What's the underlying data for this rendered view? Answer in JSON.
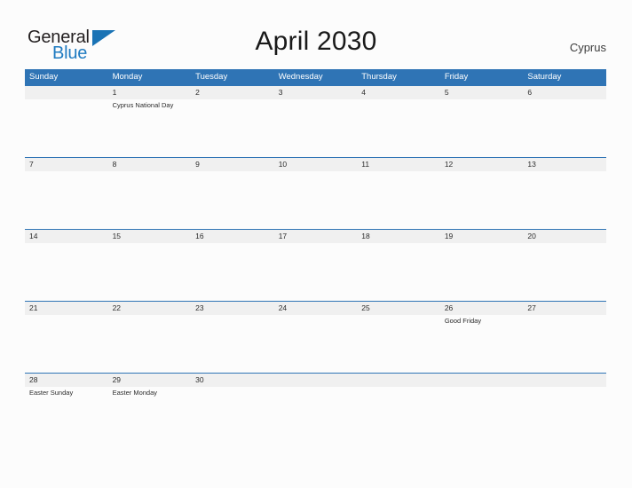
{
  "brand": {
    "name_part1": "General",
    "name_part2": "Blue",
    "flag_icon": "flag-triangle-icon"
  },
  "header": {
    "title": "April 2030",
    "region": "Cyprus"
  },
  "colors": {
    "header_blue": "#2f74b5",
    "band_gray": "#f0f0f0",
    "brand_blue": "#1f7bc1",
    "page_background": "#fcfcfc"
  },
  "calendar": {
    "day_names": [
      "Sunday",
      "Monday",
      "Tuesday",
      "Wednesday",
      "Thursday",
      "Friday",
      "Saturday"
    ],
    "weeks": [
      [
        {
          "day": "",
          "event": ""
        },
        {
          "day": "1",
          "event": "Cyprus National Day"
        },
        {
          "day": "2",
          "event": ""
        },
        {
          "day": "3",
          "event": ""
        },
        {
          "day": "4",
          "event": ""
        },
        {
          "day": "5",
          "event": ""
        },
        {
          "day": "6",
          "event": ""
        }
      ],
      [
        {
          "day": "7",
          "event": ""
        },
        {
          "day": "8",
          "event": ""
        },
        {
          "day": "9",
          "event": ""
        },
        {
          "day": "10",
          "event": ""
        },
        {
          "day": "11",
          "event": ""
        },
        {
          "day": "12",
          "event": ""
        },
        {
          "day": "13",
          "event": ""
        }
      ],
      [
        {
          "day": "14",
          "event": ""
        },
        {
          "day": "15",
          "event": ""
        },
        {
          "day": "16",
          "event": ""
        },
        {
          "day": "17",
          "event": ""
        },
        {
          "day": "18",
          "event": ""
        },
        {
          "day": "19",
          "event": ""
        },
        {
          "day": "20",
          "event": ""
        }
      ],
      [
        {
          "day": "21",
          "event": ""
        },
        {
          "day": "22",
          "event": ""
        },
        {
          "day": "23",
          "event": ""
        },
        {
          "day": "24",
          "event": ""
        },
        {
          "day": "25",
          "event": ""
        },
        {
          "day": "26",
          "event": "Good Friday"
        },
        {
          "day": "27",
          "event": ""
        }
      ],
      [
        {
          "day": "28",
          "event": "Easter Sunday"
        },
        {
          "day": "29",
          "event": "Easter Monday"
        },
        {
          "day": "30",
          "event": ""
        },
        {
          "day": "",
          "event": ""
        },
        {
          "day": "",
          "event": ""
        },
        {
          "day": "",
          "event": ""
        },
        {
          "day": "",
          "event": ""
        }
      ]
    ]
  }
}
